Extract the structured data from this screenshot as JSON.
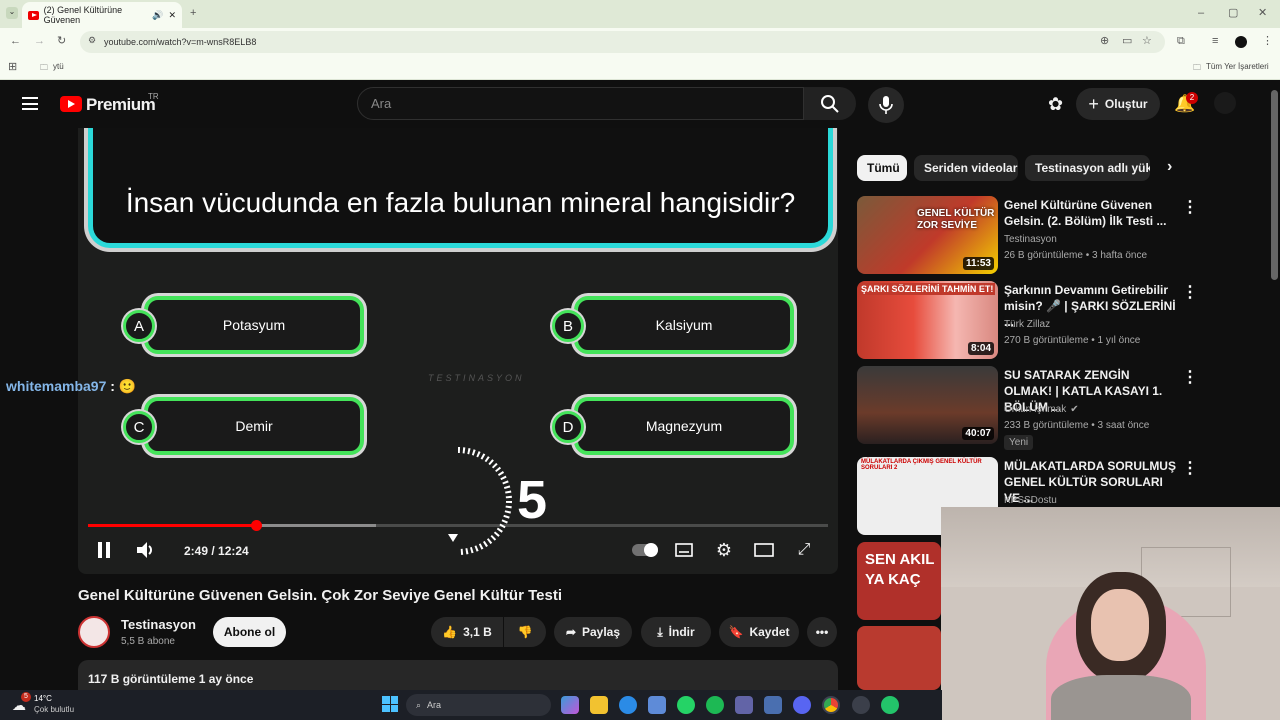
{
  "browser": {
    "tab_title": "(2) Genel Kültürüne Güvenen",
    "url": "youtube.com/watch?v=m-wnsR8ELB8",
    "bookmark_folder": "ytü",
    "bookmarks_all": "Tüm Yer İşaretleri"
  },
  "header": {
    "logo_text": "Premium",
    "region": "TR",
    "search_placeholder": "Ara",
    "create_label": "Oluştur",
    "notification_count": "2"
  },
  "video": {
    "question": "İnsan vücudunda en fazla bulunan mineral hangisidir?",
    "options": [
      {
        "letter": "A",
        "text": "Potasyum"
      },
      {
        "letter": "B",
        "text": "Kalsiyum"
      },
      {
        "letter": "C",
        "text": "Demir"
      },
      {
        "letter": "D",
        "text": "Magnezyum"
      }
    ],
    "watermark": "TESTINASYON",
    "countdown": "5",
    "time": "2:49 / 12:24",
    "progress": 0.227
  },
  "chat_overlay": {
    "user": "whitemamba97",
    "sep": ":"
  },
  "meta": {
    "title": "Genel Kültürüne Güvenen Gelsin. Çok Zor Seviye Genel Kültür Testi",
    "channel": "Testinasyon",
    "subscribers": "5,5 B abone",
    "subscribe_label": "Abone ol",
    "likes": "3,1 B",
    "share_label": "Paylaş",
    "download_label": "İndir",
    "save_label": "Kaydet",
    "views_date": "117 B görüntüleme  1 ay önce"
  },
  "sidebar": {
    "chips": [
      "Tümü",
      "Seriden videolar",
      "Testinasyon adlı yükle"
    ],
    "videos": [
      {
        "title": "Genel Kültürüne Güvenen Gelsin. (2. Bölüm) İlk Testi ...",
        "channel": "Testinasyon",
        "stats": "26 B görüntüleme • 3 hafta önce",
        "duration": "11:53",
        "thumb_text": "GENEL KÜLTÜR ZOR SEVİYE"
      },
      {
        "title": "Şarkının Devamını Getirebilir misin? 🎤 | ŞARKI SÖZLERİNİ ...",
        "channel": "Türk Zillaz",
        "stats": "270 B görüntüleme • 1 yıl önce",
        "duration": "8:04",
        "thumb_text": "ŞARKI SÖZLERİNİ TAHMİN ET!"
      },
      {
        "title": "SU SATARAK ZENGİN OLMAK! | KATLA KASAYI 1. BÖLÜM ...",
        "channel": "Orkun Işıtmak",
        "stats": "233 B görüntüleme • 3 saat önce",
        "duration": "40:07",
        "badge": "Yeni"
      },
      {
        "title": "MÜLAKATLARDA SORULMUŞ GENEL KÜLTÜR SORULARI VE ...",
        "channel": "KPSSDostu",
        "thumb_text": "MÜLAKATLARDA ÇIKMIŞ GENEL KÜLTÜR SORULARI 2"
      },
      {
        "thumb_text": "SEN AKIL YA KAÇ"
      }
    ]
  },
  "taskbar": {
    "temp": "14°C",
    "weather": "Çok bulutlu",
    "search": "Ara",
    "weather_badge": "5"
  }
}
